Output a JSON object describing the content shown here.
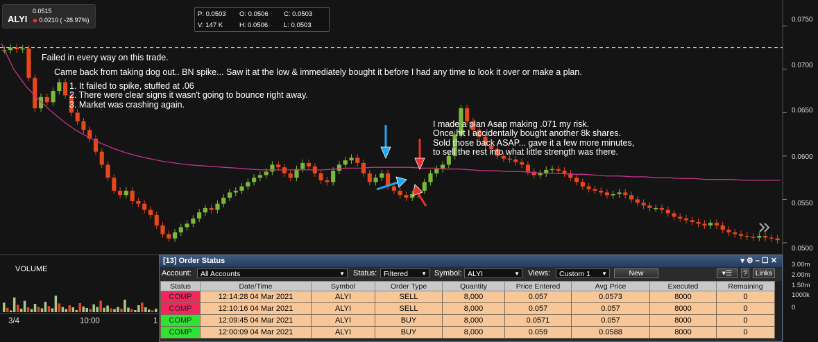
{
  "ticker": {
    "symbol": "ALYI",
    "last": "0.0515",
    "change": "0.0210 ( -28.97%)",
    "colors": {
      "down": "#e33333"
    }
  },
  "ohlc": {
    "p": "P: 0.0503",
    "o": "O: 0.0506",
    "c": "C: 0.0503",
    "v": "V: 147 K",
    "h": "H: 0.0506",
    "l": "L: 0.0503"
  },
  "annotations": {
    "headline": "Failed in every way on this trade.",
    "story": "Came back from taking dog out.. BN spike... Saw it at the low & immediately bought it before I had any time to look it over or make a plan.",
    "reasons": [
      "1. It failed to spike, stuffed at .06",
      "2. There were clear signs it wasn't going to bounce right away.",
      "3. Market was crashing again."
    ],
    "plan": [
      "I made a plan Asap making .071 my risk.",
      "Once hit I accidentally bought another 8k shares.",
      "Sold those back ASAP... gave it a few more minutes,",
      "to sell the rest into what little strength was there."
    ]
  },
  "price_axis": [
    "0.0750",
    "0.0700",
    "0.0650",
    "0.0600",
    "0.0550",
    "0.0500"
  ],
  "volume_axis": [
    "3.00m",
    "2.00m",
    "1.50m",
    "1000k",
    "0"
  ],
  "volume_title": "VOLUME",
  "time_axis": [
    "3/4",
    "10:00",
    "1"
  ],
  "chart_data": {
    "type": "candlestick",
    "ylim": [
      0.0488,
      0.0775
    ],
    "risk_level": 0.0725,
    "colors": {
      "up": "#7ab83a",
      "down": "#e8461b",
      "vwap": "#c2348c",
      "risk_line": "#bbbbbb"
    },
    "closes": [
      0.0722,
      0.0725,
      0.0723,
      0.0724,
      0.069,
      0.0655,
      0.0668,
      0.0662,
      0.0675,
      0.0685,
      0.067,
      0.065,
      0.064,
      0.063,
      0.062,
      0.0605,
      0.059,
      0.0575,
      0.056,
      0.0555,
      0.056,
      0.0548,
      0.0545,
      0.0538,
      0.0532,
      0.052,
      0.051,
      0.0505,
      0.0512,
      0.0518,
      0.0522,
      0.0528,
      0.0535,
      0.054,
      0.0538,
      0.0545,
      0.0552,
      0.0558,
      0.056,
      0.0565,
      0.057,
      0.0575,
      0.0578,
      0.0582,
      0.059,
      0.0587,
      0.058,
      0.0575,
      0.0585,
      0.0592,
      0.0588,
      0.058,
      0.0572,
      0.057,
      0.0583,
      0.059,
      0.0595,
      0.0598,
      0.0592,
      0.058,
      0.057,
      0.0575,
      0.058,
      0.0565,
      0.056,
      0.0555,
      0.0552,
      0.0556,
      0.056,
      0.057,
      0.058,
      0.0585,
      0.059,
      0.06,
      0.0625,
      0.0655,
      0.064,
      0.063,
      0.0622,
      0.0612,
      0.0608,
      0.06,
      0.0597,
      0.0596,
      0.0593,
      0.059,
      0.0582,
      0.0578,
      0.058,
      0.0584,
      0.0585,
      0.0583,
      0.058,
      0.0575,
      0.057,
      0.0565,
      0.0562,
      0.056,
      0.0558,
      0.0555,
      0.0556,
      0.0558,
      0.0555,
      0.055,
      0.0546,
      0.0543,
      0.054,
      0.054,
      0.0538,
      0.0534,
      0.053,
      0.0528,
      0.0526,
      0.0524,
      0.0522,
      0.052,
      0.0523,
      0.052,
      0.0515,
      0.0512,
      0.051,
      0.0508,
      0.0507,
      0.0506,
      0.0508,
      0.0506,
      0.0505,
      0.0503
    ],
    "vwap": [
      0.073,
      0.07,
      0.068,
      0.0665,
      0.0652,
      0.064,
      0.063,
      0.0622,
      0.0615,
      0.0609,
      0.0604,
      0.06,
      0.0597,
      0.0594,
      0.0592,
      0.059,
      0.0589,
      0.0588,
      0.0587,
      0.0586,
      0.0585,
      0.0584,
      0.0584,
      0.0584,
      0.0584,
      0.0584,
      0.0584,
      0.0585,
      0.0586,
      0.0586,
      0.0587,
      0.0587,
      0.0587,
      0.0587,
      0.0586,
      0.0586,
      0.0585,
      0.0585,
      0.0584,
      0.0583,
      0.0583,
      0.0582,
      0.0582,
      0.0581,
      0.058,
      0.058,
      0.0579,
      0.0579,
      0.0578,
      0.0577,
      0.0577,
      0.0576,
      0.0576,
      0.0575,
      0.0575,
      0.0574,
      0.0574,
      0.0573,
      0.0573,
      0.0573,
      0.0572,
      0.0572,
      0.0572,
      0.0572
    ],
    "volume": [
      0.55,
      0.25,
      0.1,
      0.85,
      0.42,
      0.2,
      0.65,
      0.28,
      0.18,
      0.48,
      0.3,
      0.22,
      0.6,
      0.35,
      0.22,
      0.95,
      0.5,
      0.3,
      0.18,
      0.4,
      0.28,
      0.12,
      0.52,
      0.33,
      0.24,
      0.18,
      0.45,
      0.3,
      0.66,
      0.25,
      0.38,
      0.22,
      0.18,
      0.3,
      0.2,
      0.72,
      0.26,
      0.18,
      0.12,
      0.4,
      0.55,
      0.28,
      0.15,
      0.1,
      0.2
    ],
    "volume_ylim": [
      0,
      3.0
    ]
  },
  "order_window": {
    "title": "[13] Order Status",
    "account_label": "Account:",
    "account_value": "All Accounts",
    "status_label": "Status:",
    "status_value": "Filtered",
    "symbol_label": "Symbol:",
    "symbol_value": "ALYI",
    "views_label": "Views:",
    "views_value": "Custom 1",
    "new_button": "New",
    "help_button": "?",
    "links_button": "Links",
    "columns": [
      "Status",
      "Date/Time",
      "Symbol",
      "Order Type",
      "Quantity",
      "Price Entered",
      "Avg Price",
      "Executed",
      "Remaining"
    ],
    "rows": [
      {
        "status": "COMP",
        "datetime": "12:14:28 04 Mar 2021",
        "symbol": "ALYI",
        "type": "SELL",
        "qty": "8,000",
        "price": "0.057",
        "avg": "0.0573",
        "executed": "8000",
        "remaining": "0"
      },
      {
        "status": "COMP",
        "datetime": "12:10:16 04 Mar 2021",
        "symbol": "ALYI",
        "type": "SELL",
        "qty": "8,000",
        "price": "0.057",
        "avg": "0.057",
        "executed": "8000",
        "remaining": "0"
      },
      {
        "status": "COMP",
        "datetime": "12:09:45 04 Mar 2021",
        "symbol": "ALYI",
        "type": "BUY",
        "qty": "8,000",
        "price": "0.0571",
        "avg": "0.057",
        "executed": "8000",
        "remaining": "0"
      },
      {
        "status": "COMP",
        "datetime": "12:00:09 04 Mar 2021",
        "symbol": "ALYI",
        "type": "BUY",
        "qty": "8,000",
        "price": "0.059",
        "avg": "0.0588",
        "executed": "8000",
        "remaining": "0"
      }
    ]
  }
}
